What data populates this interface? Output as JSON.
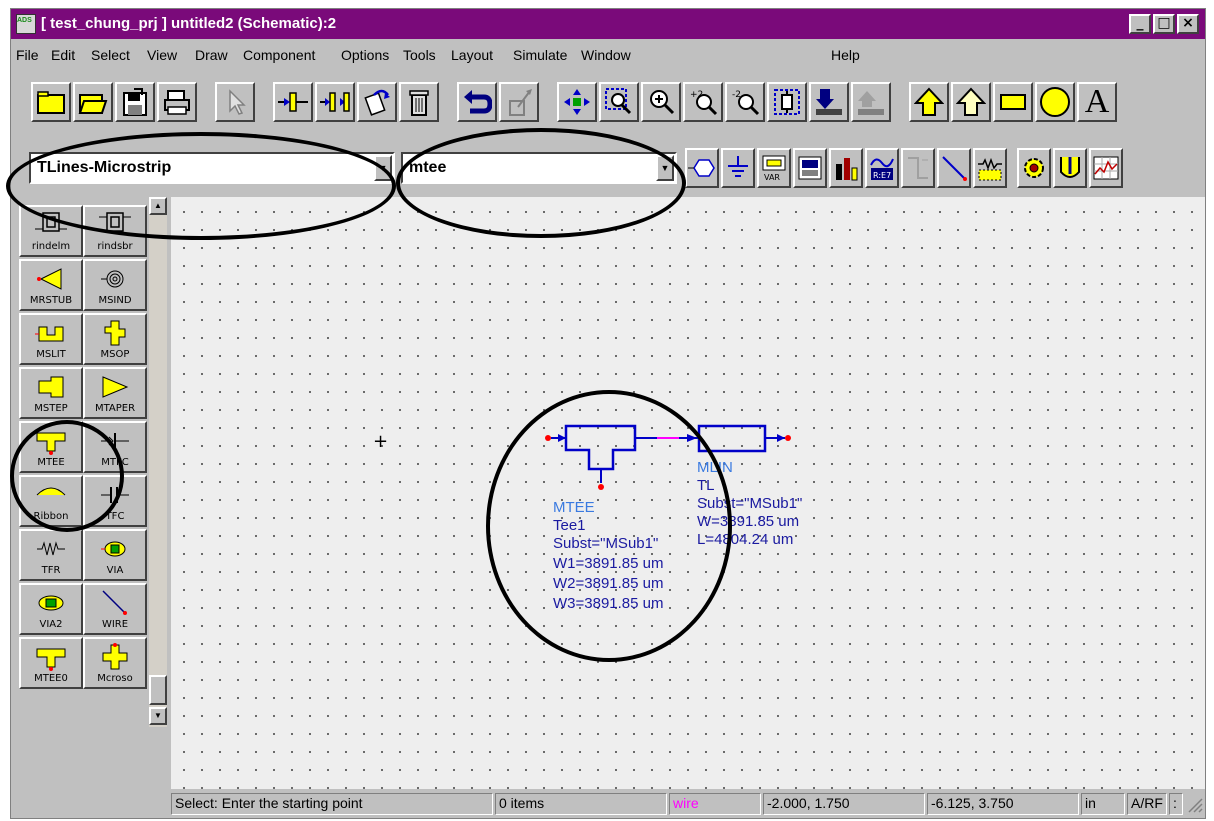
{
  "window": {
    "title": "[ test_chung_prj ] untitled2 (Schematic):2",
    "app_icon_text": "ADS",
    "minimize": "_",
    "maximize": "□",
    "close": "×"
  },
  "menu": [
    "File",
    "Edit",
    "Select",
    "View",
    "Draw",
    "Component",
    "Options",
    "Tools",
    "Layout",
    "Simulate",
    "Window",
    "Help"
  ],
  "toolbar": {
    "icons": [
      "new-folder-icon",
      "open-folder-icon",
      "save-icon",
      "print-icon",
      "select-arrow-icon",
      "insert-component-icon",
      "mirror-component-icon",
      "rotate-icon",
      "delete-icon",
      "undo-icon",
      "redo-icon",
      "move-icon",
      "zoom-area-icon",
      "zoom-icon",
      "zoom-in-icon",
      "zoom-out-icon",
      "view-all-icon",
      "push-into-icon",
      "pop-out-icon",
      "arrow-up-icon",
      "arrow-up-outline-icon",
      "rectangle-icon",
      "circle-icon",
      "text-icon"
    ],
    "zoom_in_label": "+2",
    "zoom_out_label": "-2",
    "text_tool_label": "A"
  },
  "library_combo": {
    "value": "TLines-Microstrip"
  },
  "component_combo": {
    "value": "mtee"
  },
  "toolbar2": {
    "icons": [
      "port-icon",
      "ground-icon",
      "var-icon",
      "display-icon",
      "data-icon",
      "measure-eqn-icon",
      "disabled-port-icon",
      "wire-icon",
      "resistor-icon",
      "gear-icon",
      "tuning-icon",
      "graph-icon"
    ],
    "var_label": "VAR",
    "eqn_label": "R:E7"
  },
  "palette": {
    "items": [
      "rindelm",
      "rindsbr",
      "MRSTUB",
      "MSIND",
      "MSLIT",
      "MSOP",
      "MSTEP",
      "MTAPER",
      "MTEE",
      "MTFC",
      "Ribbon",
      "TFC",
      "TFR",
      "VIA",
      "VIA2",
      "WIRE",
      "MTEE0",
      "Mcroso"
    ]
  },
  "canvas": {
    "cursor": "+",
    "mtee": {
      "type": "MTEE",
      "name": "Tee1",
      "subst": "Subst=\"MSub1\"",
      "w1": "W1=3891.85 um",
      "w2": "W2=3891.85 um",
      "w3": "W3=3891.85 um"
    },
    "mlin": {
      "type": "MLIN",
      "name": "TL",
      "subst": "Subst=\"MSub1\"",
      "w": "W=3891.85 um",
      "l": "L=4804.24 um"
    }
  },
  "status": {
    "prompt": "Select: Enter the starting point",
    "items": "0 items",
    "mode": "wire",
    "coord1": "-2.000, 1.750",
    "coord2": "-6.125, 3.750",
    "units": "in",
    "domain": "A/RF",
    "extra": ":"
  },
  "colors": {
    "titlebar": "#7a0a7a",
    "wire_mode": "#ff00ff",
    "component": "#0000c8",
    "pin": "#ff0000"
  }
}
